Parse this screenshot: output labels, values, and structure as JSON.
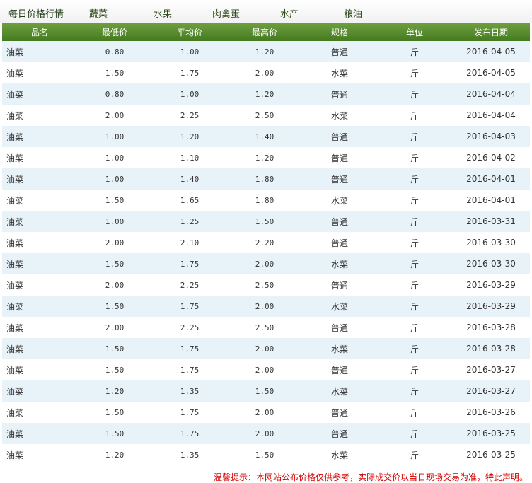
{
  "nav": {
    "title": "每日价格行情",
    "items": [
      "蔬菜",
      "水果",
      "肉禽蛋",
      "水产",
      "粮油"
    ]
  },
  "table": {
    "headers": [
      "品名",
      "最低价",
      "平均价",
      "最高价",
      "规格",
      "单位",
      "发布日期"
    ],
    "rows": [
      [
        "油菜",
        "0.80",
        "1.00",
        "1.20",
        "普通",
        "斤",
        "2016-04-05"
      ],
      [
        "油菜",
        "1.50",
        "1.75",
        "2.00",
        "水菜",
        "斤",
        "2016-04-05"
      ],
      [
        "油菜",
        "0.80",
        "1.00",
        "1.20",
        "普通",
        "斤",
        "2016-04-04"
      ],
      [
        "油菜",
        "2.00",
        "2.25",
        "2.50",
        "水菜",
        "斤",
        "2016-04-04"
      ],
      [
        "油菜",
        "1.00",
        "1.20",
        "1.40",
        "普通",
        "斤",
        "2016-04-03"
      ],
      [
        "油菜",
        "1.00",
        "1.10",
        "1.20",
        "普通",
        "斤",
        "2016-04-02"
      ],
      [
        "油菜",
        "1.00",
        "1.40",
        "1.80",
        "普通",
        "斤",
        "2016-04-01"
      ],
      [
        "油菜",
        "1.50",
        "1.65",
        "1.80",
        "水菜",
        "斤",
        "2016-04-01"
      ],
      [
        "油菜",
        "1.00",
        "1.25",
        "1.50",
        "普通",
        "斤",
        "2016-03-31"
      ],
      [
        "油菜",
        "2.00",
        "2.10",
        "2.20",
        "普通",
        "斤",
        "2016-03-30"
      ],
      [
        "油菜",
        "1.50",
        "1.75",
        "2.00",
        "水菜",
        "斤",
        "2016-03-30"
      ],
      [
        "油菜",
        "2.00",
        "2.25",
        "2.50",
        "普通",
        "斤",
        "2016-03-29"
      ],
      [
        "油菜",
        "1.50",
        "1.75",
        "2.00",
        "水菜",
        "斤",
        "2016-03-29"
      ],
      [
        "油菜",
        "2.00",
        "2.25",
        "2.50",
        "普通",
        "斤",
        "2016-03-28"
      ],
      [
        "油菜",
        "1.50",
        "1.75",
        "2.00",
        "水菜",
        "斤",
        "2016-03-28"
      ],
      [
        "油菜",
        "1.50",
        "1.75",
        "2.00",
        "普通",
        "斤",
        "2016-03-27"
      ],
      [
        "油菜",
        "1.20",
        "1.35",
        "1.50",
        "水菜",
        "斤",
        "2016-03-27"
      ],
      [
        "油菜",
        "1.50",
        "1.75",
        "2.00",
        "普通",
        "斤",
        "2016-03-26"
      ],
      [
        "油菜",
        "1.50",
        "1.75",
        "2.00",
        "普通",
        "斤",
        "2016-03-25"
      ],
      [
        "油菜",
        "1.20",
        "1.35",
        "1.50",
        "水菜",
        "斤",
        "2016-03-25"
      ]
    ]
  },
  "notice": "温馨提示：本网站公布价格仅供参考，实际成交价以当日现场交易为准，特此声明。",
  "colors": {
    "header_bg": "#4f862a",
    "row_odd": "#e8f2f9",
    "notice_text": "#d40000"
  }
}
